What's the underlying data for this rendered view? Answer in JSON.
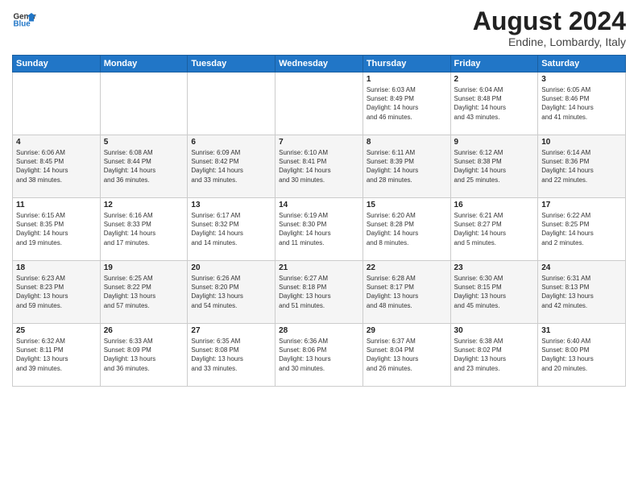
{
  "logo": {
    "line1": "General",
    "line2": "Blue"
  },
  "title": {
    "month_year": "August 2024",
    "location": "Endine, Lombardy, Italy"
  },
  "weekdays": [
    "Sunday",
    "Monday",
    "Tuesday",
    "Wednesday",
    "Thursday",
    "Friday",
    "Saturday"
  ],
  "weeks": [
    [
      {
        "day": "",
        "info": ""
      },
      {
        "day": "",
        "info": ""
      },
      {
        "day": "",
        "info": ""
      },
      {
        "day": "",
        "info": ""
      },
      {
        "day": "1",
        "info": "Sunrise: 6:03 AM\nSunset: 8:49 PM\nDaylight: 14 hours\nand 46 minutes."
      },
      {
        "day": "2",
        "info": "Sunrise: 6:04 AM\nSunset: 8:48 PM\nDaylight: 14 hours\nand 43 minutes."
      },
      {
        "day": "3",
        "info": "Sunrise: 6:05 AM\nSunset: 8:46 PM\nDaylight: 14 hours\nand 41 minutes."
      }
    ],
    [
      {
        "day": "4",
        "info": "Sunrise: 6:06 AM\nSunset: 8:45 PM\nDaylight: 14 hours\nand 38 minutes."
      },
      {
        "day": "5",
        "info": "Sunrise: 6:08 AM\nSunset: 8:44 PM\nDaylight: 14 hours\nand 36 minutes."
      },
      {
        "day": "6",
        "info": "Sunrise: 6:09 AM\nSunset: 8:42 PM\nDaylight: 14 hours\nand 33 minutes."
      },
      {
        "day": "7",
        "info": "Sunrise: 6:10 AM\nSunset: 8:41 PM\nDaylight: 14 hours\nand 30 minutes."
      },
      {
        "day": "8",
        "info": "Sunrise: 6:11 AM\nSunset: 8:39 PM\nDaylight: 14 hours\nand 28 minutes."
      },
      {
        "day": "9",
        "info": "Sunrise: 6:12 AM\nSunset: 8:38 PM\nDaylight: 14 hours\nand 25 minutes."
      },
      {
        "day": "10",
        "info": "Sunrise: 6:14 AM\nSunset: 8:36 PM\nDaylight: 14 hours\nand 22 minutes."
      }
    ],
    [
      {
        "day": "11",
        "info": "Sunrise: 6:15 AM\nSunset: 8:35 PM\nDaylight: 14 hours\nand 19 minutes."
      },
      {
        "day": "12",
        "info": "Sunrise: 6:16 AM\nSunset: 8:33 PM\nDaylight: 14 hours\nand 17 minutes."
      },
      {
        "day": "13",
        "info": "Sunrise: 6:17 AM\nSunset: 8:32 PM\nDaylight: 14 hours\nand 14 minutes."
      },
      {
        "day": "14",
        "info": "Sunrise: 6:19 AM\nSunset: 8:30 PM\nDaylight: 14 hours\nand 11 minutes."
      },
      {
        "day": "15",
        "info": "Sunrise: 6:20 AM\nSunset: 8:28 PM\nDaylight: 14 hours\nand 8 minutes."
      },
      {
        "day": "16",
        "info": "Sunrise: 6:21 AM\nSunset: 8:27 PM\nDaylight: 14 hours\nand 5 minutes."
      },
      {
        "day": "17",
        "info": "Sunrise: 6:22 AM\nSunset: 8:25 PM\nDaylight: 14 hours\nand 2 minutes."
      }
    ],
    [
      {
        "day": "18",
        "info": "Sunrise: 6:23 AM\nSunset: 8:23 PM\nDaylight: 13 hours\nand 59 minutes."
      },
      {
        "day": "19",
        "info": "Sunrise: 6:25 AM\nSunset: 8:22 PM\nDaylight: 13 hours\nand 57 minutes."
      },
      {
        "day": "20",
        "info": "Sunrise: 6:26 AM\nSunset: 8:20 PM\nDaylight: 13 hours\nand 54 minutes."
      },
      {
        "day": "21",
        "info": "Sunrise: 6:27 AM\nSunset: 8:18 PM\nDaylight: 13 hours\nand 51 minutes."
      },
      {
        "day": "22",
        "info": "Sunrise: 6:28 AM\nSunset: 8:17 PM\nDaylight: 13 hours\nand 48 minutes."
      },
      {
        "day": "23",
        "info": "Sunrise: 6:30 AM\nSunset: 8:15 PM\nDaylight: 13 hours\nand 45 minutes."
      },
      {
        "day": "24",
        "info": "Sunrise: 6:31 AM\nSunset: 8:13 PM\nDaylight: 13 hours\nand 42 minutes."
      }
    ],
    [
      {
        "day": "25",
        "info": "Sunrise: 6:32 AM\nSunset: 8:11 PM\nDaylight: 13 hours\nand 39 minutes."
      },
      {
        "day": "26",
        "info": "Sunrise: 6:33 AM\nSunset: 8:09 PM\nDaylight: 13 hours\nand 36 minutes."
      },
      {
        "day": "27",
        "info": "Sunrise: 6:35 AM\nSunset: 8:08 PM\nDaylight: 13 hours\nand 33 minutes."
      },
      {
        "day": "28",
        "info": "Sunrise: 6:36 AM\nSunset: 8:06 PM\nDaylight: 13 hours\nand 30 minutes."
      },
      {
        "day": "29",
        "info": "Sunrise: 6:37 AM\nSunset: 8:04 PM\nDaylight: 13 hours\nand 26 minutes."
      },
      {
        "day": "30",
        "info": "Sunrise: 6:38 AM\nSunset: 8:02 PM\nDaylight: 13 hours\nand 23 minutes."
      },
      {
        "day": "31",
        "info": "Sunrise: 6:40 AM\nSunset: 8:00 PM\nDaylight: 13 hours\nand 20 minutes."
      }
    ]
  ]
}
